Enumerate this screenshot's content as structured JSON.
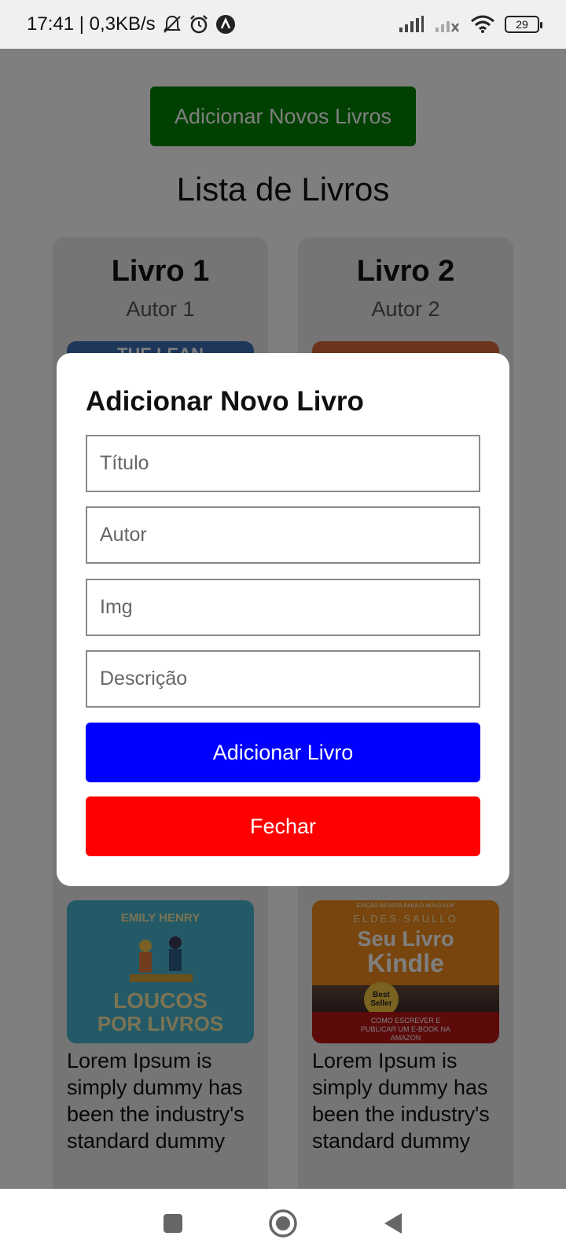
{
  "status_bar": {
    "time_speed": "17:41 | 0,3KB/s",
    "battery": "29"
  },
  "header": {
    "add_button_label": "Adicionar Novos Livros",
    "list_title": "Lista de Livros"
  },
  "books": [
    {
      "title": "Livro 1",
      "author": "Autor 1",
      "cover_title_top": "THE LEAN",
      "cover_author": "EMILY HENRY",
      "cover_line1": "LOUCOS",
      "cover_line2": "POR LIVROS",
      "description": "Lorem Ipsum is simply dummy has been the industry's standard dummy"
    },
    {
      "title": "Livro 2",
      "author": "Autor 2",
      "cover_header": "EDIÇÃO REVISTA PARA O NOVO KDP",
      "cover_author": "ELDES SAULLO",
      "cover_line1": "Seu Livro",
      "cover_line2": "Kindle",
      "cover_badge": "Best Seller",
      "cover_footer": "COMO ESCREVER E PUBLICAR UM E-BOOK NA AMAZON",
      "description": "Lorem Ipsum is simply dummy has been the industry's standard dummy"
    }
  ],
  "modal": {
    "title": "Adicionar Novo Livro",
    "fields": {
      "title_placeholder": "Título",
      "author_placeholder": "Autor",
      "img_placeholder": "Img",
      "description_placeholder": "Descrição"
    },
    "submit_label": "Adicionar Livro",
    "close_label": "Fechar"
  },
  "colors": {
    "add_new": "#008000",
    "submit": "#0000ff",
    "close": "#ff0000"
  }
}
